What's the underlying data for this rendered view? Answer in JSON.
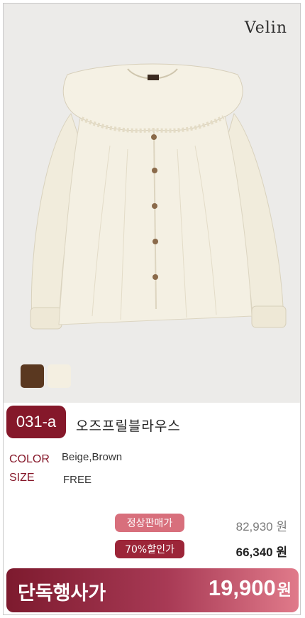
{
  "brand": "Velin",
  "product": {
    "code": "031-a",
    "name": "오즈프릴블라우스",
    "color_label": "COLOR",
    "color_value": "Beige,Brown",
    "size_label": "SIZE",
    "size_value": "FREE"
  },
  "swatches": [
    "brown",
    "beige"
  ],
  "prices": {
    "regular_label": "정상판매가",
    "regular_value": "82,930 원",
    "sale_label": "70%할인가",
    "sale_value": "66,340 원"
  },
  "banner": {
    "label": "단독행사가",
    "price": "19,900",
    "unit": "원"
  },
  "colors": {
    "accent": "#85182a",
    "pill_regular": "#d86f7c",
    "pill_sale": "#9c2538"
  }
}
